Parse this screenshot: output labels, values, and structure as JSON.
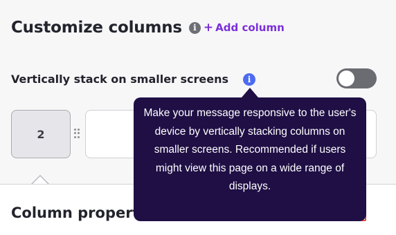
{
  "header": {
    "title": "Customize columns",
    "info_glyph": "i",
    "add_plus": "+",
    "add_label": "Add column"
  },
  "stack": {
    "label": "Vertically stack on smaller screens",
    "info_glyph": "i",
    "toggle_on": false
  },
  "columns": [
    {
      "label": "2"
    },
    {
      "label": ""
    }
  ],
  "properties": {
    "title": "Column propert"
  },
  "tooltip": {
    "text": "Make your message responsive to the user's device by vertically stacking columns on smaller screens. Recommended if users might view this page on a wide range of displays."
  },
  "colors": {
    "accent": "#7c2fd9",
    "info_blue": "#4d6bf0",
    "tooltip_bg": "#1f0f45",
    "toggle_off": "#6b6b72"
  },
  "icons": [
    "info-icon",
    "plus-icon",
    "drag-handle-icon"
  ]
}
